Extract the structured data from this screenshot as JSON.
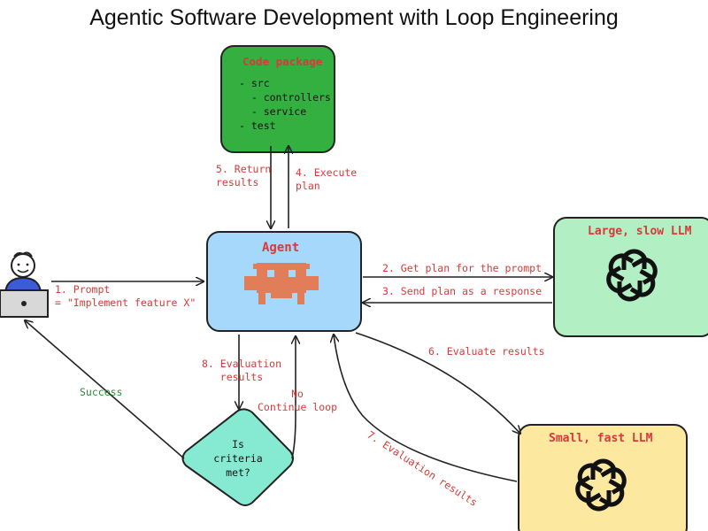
{
  "title": "Agentic Software Development with Loop Engineering",
  "nodes": {
    "code_package": {
      "title": "Code package",
      "tree": [
        "- src",
        "  - controllers",
        "  - service",
        "- test"
      ],
      "fill": "#33b040"
    },
    "agent": {
      "title": "Agent",
      "fill": "#a6d8fb",
      "icon": "robot-icon",
      "icon_color": "#e27d5a"
    },
    "large_llm": {
      "title": "Large, slow LLM",
      "fill": "#b2efc2",
      "icon": "openai-logo-icon"
    },
    "small_llm": {
      "title": "Small, fast LLM",
      "fill": "#fde8a0",
      "icon": "openai-logo-icon"
    },
    "decision": {
      "lines": [
        "Is",
        "criteria",
        "met?"
      ],
      "fill": "#86ead3"
    },
    "user": {
      "icon": "developer-laptop-icon"
    }
  },
  "edges": {
    "prompt": [
      "1. Prompt",
      "= \"Implement feature X\""
    ],
    "get_plan": "2. Get plan for the prompt",
    "send_plan": "3. Send plan as a response",
    "execute_plan": [
      "4. Execute",
      "plan"
    ],
    "return_results": [
      "5. Return",
      "results"
    ],
    "evaluate_results": "6. Evaluate results",
    "evaluation_results_small": "7. Evaluation results",
    "evaluation_results": [
      "8. Evaluation",
      "results"
    ],
    "no_continue": [
      "No",
      "Continue loop"
    ],
    "success": "Success"
  },
  "colors": {
    "label_red": "#d63a3a",
    "label_green": "#2e8b3a",
    "stroke": "#222222"
  }
}
